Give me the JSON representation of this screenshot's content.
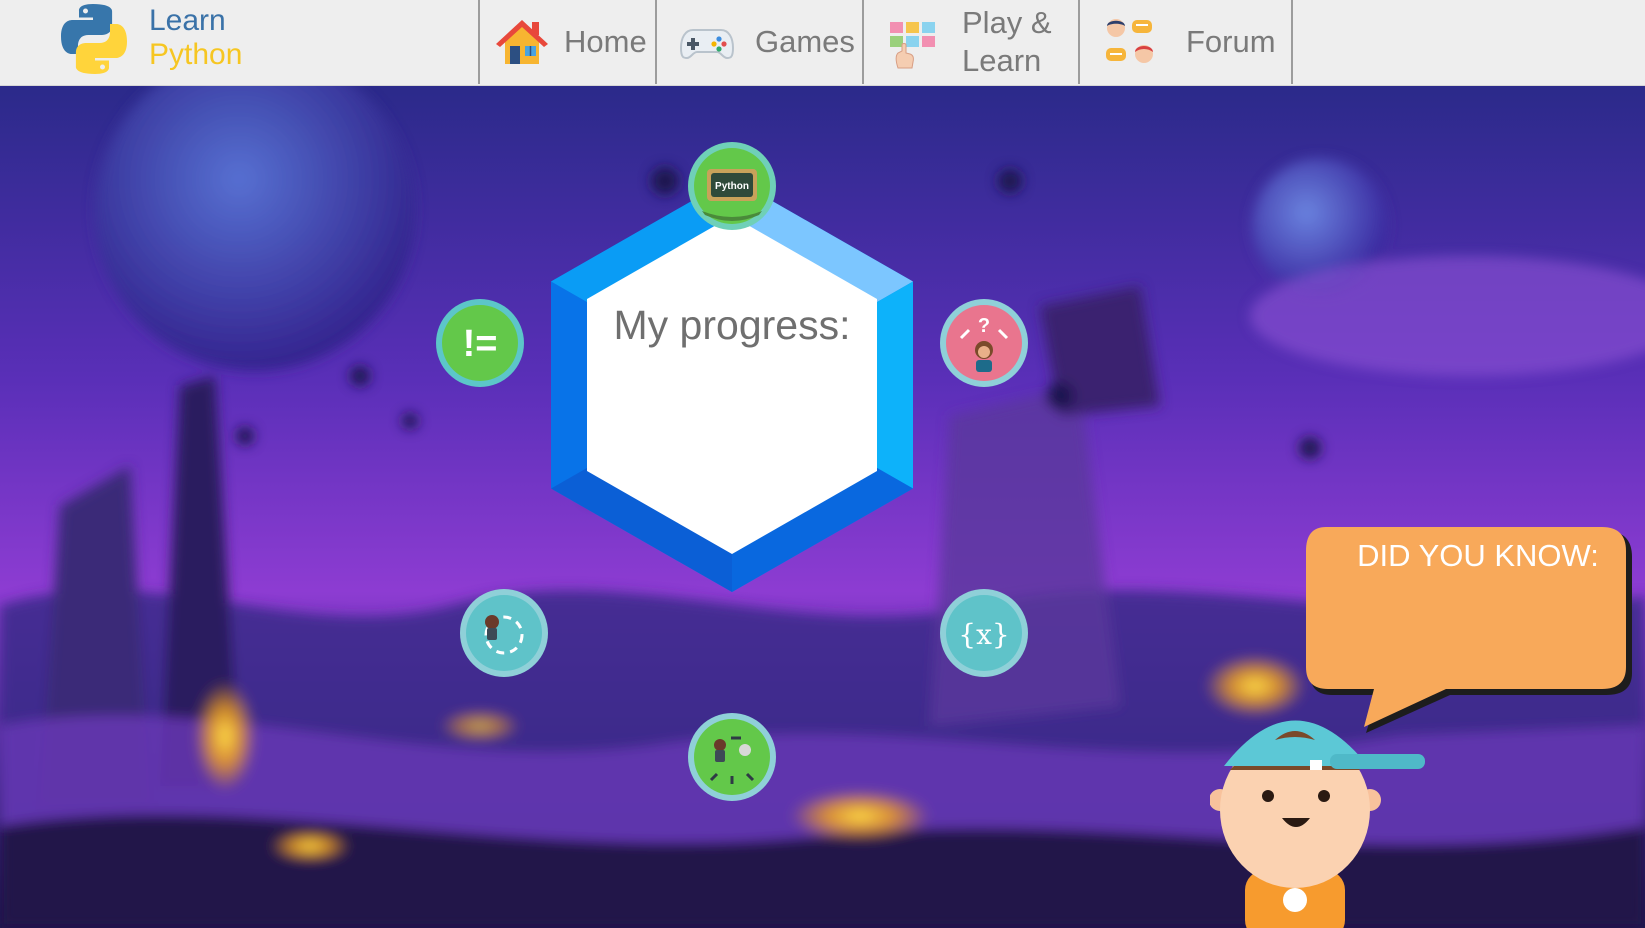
{
  "brand": {
    "line1": "Learn",
    "line2": "Python"
  },
  "nav": [
    {
      "label": "Home",
      "icon": "house-icon"
    },
    {
      "label": "Games",
      "icon": "gamepad-icon"
    },
    {
      "label": "Play & Learn",
      "label_line1": "Play &",
      "label_line2": "Learn",
      "icon": "abc-blocks-icon"
    },
    {
      "label": "Forum",
      "icon": "chat-people-icon"
    }
  ],
  "progress": {
    "title": "My progress:"
  },
  "badges": [
    {
      "name": "python-intro-badge",
      "text": "Python",
      "color": "#63c84a"
    },
    {
      "name": "conditions-badge",
      "text": "!=",
      "color": "#63c84a"
    },
    {
      "name": "choices-badge",
      "text": "?",
      "color": "#e9758e"
    },
    {
      "name": "loops-badge",
      "color": "#5fc3c9"
    },
    {
      "name": "variables-badge",
      "text": "{x}",
      "color": "#5fc3c9"
    },
    {
      "name": "movement-badge",
      "color": "#63c84a"
    }
  ],
  "tip": {
    "title": "DID YOU KNOW:",
    "color": "#f8a95a"
  },
  "colors": {
    "header_bg": "#eeeeee",
    "hex_outer": "#0a84f0",
    "hex_light": "#7cc6ff"
  }
}
